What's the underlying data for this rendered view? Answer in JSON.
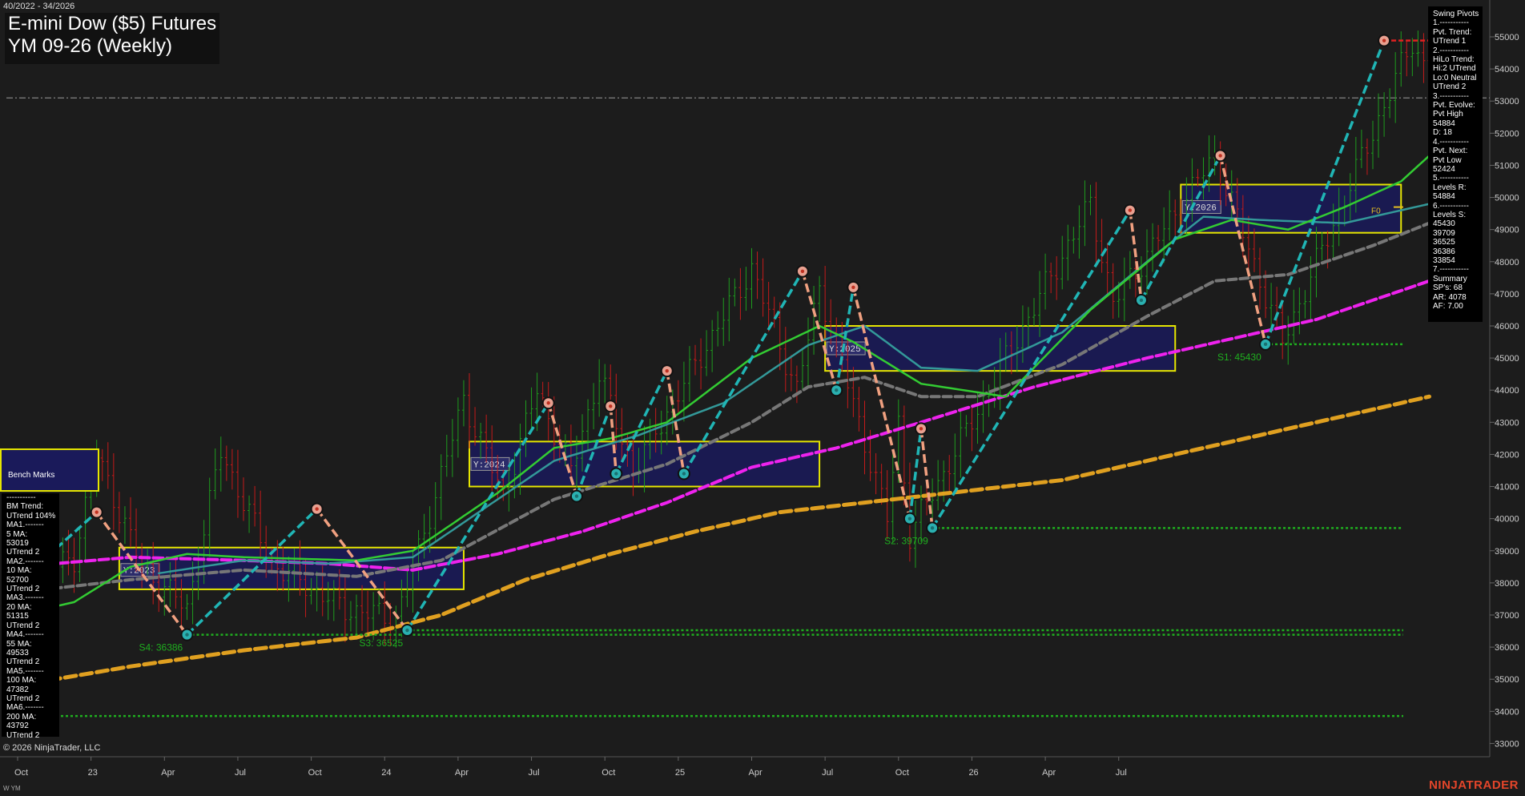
{
  "header": {
    "date_range": "40/2022 - 34/2026",
    "title_line1": "E-mini Dow ($5) Futures",
    "title_line2": "YM 09-26 (Weekly)",
    "copyright": "© 2026 NinjaTrader, LLC",
    "instrument_tag": "W YM",
    "brand": "NINJATRADER"
  },
  "swing_panel": {
    "lines": [
      "Swing Pivots",
      "1.-----------",
      "Pvt. Trend:",
      "UTrend 1",
      "2.-----------",
      "HiLo Trend:",
      "Hi:2 UTrend",
      "Lo:0 Neutral",
      "UTrend 2",
      "3.-----------",
      "Pvt. Evolve:",
      "Pvt High",
      "54884",
      "D: 18",
      "4.-----------",
      "Pvt. Next:",
      "Pvt Low",
      "52424",
      "5.-----------",
      "Levels R:",
      "54884",
      "6.-----------",
      "Levels S:",
      "45430",
      "39709",
      "36525",
      "36386",
      "33854",
      "7.-----------",
      "Summary",
      "SP's: 68",
      "AR: 4078",
      "AF: 7.00"
    ]
  },
  "bench_panel": {
    "heading": "Bench Marks",
    "lines": [
      "-----------",
      "BM Trend:",
      "UTrend 104%",
      "MA1.-------",
      "5 MA:",
      "53019",
      "UTrend 2",
      "MA2.-------",
      "10 MA:",
      "52700",
      "UTrend 2",
      "MA3.-------",
      "20 MA:",
      "51315",
      "UTrend 2",
      "MA4.-------",
      "55 MA:",
      "49533",
      "UTrend 2",
      "MA5.-------",
      "100 MA:",
      "47382",
      "UTrend 2",
      "MA6.-------",
      "200 MA:",
      "43792",
      "UTrend 2"
    ]
  },
  "colors": {
    "background": "#1c1c1c",
    "up_bar": "#1e9c1e",
    "down_bar": "#c41a1a",
    "ma_fast": "#33cc33",
    "ma_mid": "#339999",
    "ma_grey": "#777777",
    "ma_magenta": "#ee22ee",
    "ma_orange": "#e0a020",
    "swing_up": "#20b5b5",
    "swing_down": "#f0a080",
    "support": "#1fae1f",
    "year_box_fill": "#1a1a5a",
    "year_box_border": "#e6e600"
  },
  "chart_data": {
    "type": "candlestick",
    "y_axis": {
      "min": 32500,
      "max": 56000,
      "ticks": [
        33000,
        34000,
        35000,
        36000,
        37000,
        38000,
        39000,
        40000,
        41000,
        42000,
        43000,
        44000,
        45000,
        46000,
        47000,
        48000,
        49000,
        50000,
        51000,
        52000,
        53000,
        54000,
        55000
      ],
      "tick_labels": [
        "33000",
        "34000",
        "35000",
        "36000",
        "37000",
        "38000",
        "39000",
        "40000",
        "41000",
        "42000",
        "43000",
        "44000",
        "45000",
        "46000",
        "47000",
        "48000",
        "49000",
        "50000",
        "51000",
        "52000",
        "53000",
        "54000",
        "55000"
      ]
    },
    "x_axis": {
      "labels": [
        "Oct",
        "23",
        "Apr",
        "Jul",
        "Oct",
        "24",
        "Apr",
        "Jul",
        "Oct",
        "25",
        "Apr",
        "Jul",
        "Oct",
        "26",
        "Apr",
        "Jul"
      ]
    },
    "last_price": 53100,
    "series_anchors": {
      "price_path": [
        [
          0,
          37800
        ],
        [
          10,
          38800
        ],
        [
          14,
          42000
        ],
        [
          22,
          38500
        ],
        [
          30,
          37200
        ],
        [
          36,
          42100
        ],
        [
          45,
          38600
        ],
        [
          58,
          37200
        ],
        [
          67,
          36900
        ],
        [
          70,
          38400
        ],
        [
          79,
          43700
        ],
        [
          86,
          40700
        ],
        [
          92,
          44000
        ],
        [
          98,
          41500
        ],
        [
          103,
          44500
        ],
        [
          109,
          41500
        ],
        [
          130,
          47800
        ],
        [
          138,
          44000
        ],
        [
          142,
          47200
        ],
        [
          154,
          40000
        ],
        [
          156,
          43000
        ],
        [
          158,
          39500
        ],
        [
          190,
          49800
        ],
        [
          194,
          46700
        ],
        [
          212,
          51300
        ],
        [
          224,
          45500
        ],
        [
          247,
          54884
        ],
        [
          252,
          53000
        ]
      ],
      "ma_fast": [
        [
          0,
          37000
        ],
        [
          10,
          37400
        ],
        [
          20,
          38500
        ],
        [
          30,
          38900
        ],
        [
          40,
          38800
        ],
        [
          60,
          38700
        ],
        [
          70,
          39000
        ],
        [
          85,
          40800
        ],
        [
          95,
          42200
        ],
        [
          105,
          42500
        ],
        [
          115,
          43000
        ],
        [
          130,
          45000
        ],
        [
          142,
          46000
        ],
        [
          148,
          45500
        ],
        [
          160,
          44200
        ],
        [
          175,
          43800
        ],
        [
          190,
          46500
        ],
        [
          205,
          48700
        ],
        [
          215,
          49300
        ],
        [
          225,
          49000
        ],
        [
          235,
          49700
        ],
        [
          245,
          50500
        ],
        [
          250,
          51300
        ]
      ],
      "ma_mid": [
        [
          25,
          38300
        ],
        [
          40,
          38700
        ],
        [
          55,
          38600
        ],
        [
          70,
          38800
        ],
        [
          80,
          40000
        ],
        [
          95,
          41800
        ],
        [
          110,
          42600
        ],
        [
          125,
          43600
        ],
        [
          140,
          45400
        ],
        [
          150,
          46000
        ],
        [
          160,
          44700
        ],
        [
          170,
          44600
        ],
        [
          185,
          45800
        ],
        [
          200,
          48000
        ],
        [
          210,
          49400
        ],
        [
          220,
          49300
        ],
        [
          235,
          49200
        ],
        [
          245,
          49600
        ],
        [
          250,
          49800
        ]
      ],
      "ma_grey": [
        [
          0,
          37700
        ],
        [
          20,
          38100
        ],
        [
          40,
          38400
        ],
        [
          60,
          38200
        ],
        [
          75,
          38700
        ],
        [
          95,
          40600
        ],
        [
          115,
          41700
        ],
        [
          130,
          43000
        ],
        [
          140,
          44100
        ],
        [
          150,
          44400
        ],
        [
          160,
          43800
        ],
        [
          170,
          43800
        ],
        [
          185,
          44800
        ],
        [
          200,
          46300
        ],
        [
          212,
          47400
        ],
        [
          225,
          47600
        ],
        [
          240,
          48500
        ],
        [
          250,
          49200
        ]
      ],
      "ma_magenta": [
        [
          0,
          38500
        ],
        [
          20,
          38800
        ],
        [
          40,
          38700
        ],
        [
          55,
          38600
        ],
        [
          70,
          38400
        ],
        [
          85,
          38900
        ],
        [
          100,
          39600
        ],
        [
          115,
          40500
        ],
        [
          130,
          41600
        ],
        [
          145,
          42200
        ],
        [
          160,
          43000
        ],
        [
          180,
          44100
        ],
        [
          200,
          45000
        ],
        [
          215,
          45600
        ],
        [
          230,
          46200
        ],
        [
          245,
          47100
        ],
        [
          250,
          47400
        ]
      ],
      "ma_orange": [
        [
          0,
          34800
        ],
        [
          20,
          35400
        ],
        [
          40,
          35900
        ],
        [
          60,
          36300
        ],
        [
          75,
          37000
        ],
        [
          90,
          38100
        ],
        [
          105,
          38900
        ],
        [
          120,
          39600
        ],
        [
          135,
          40200
        ],
        [
          150,
          40500
        ],
        [
          165,
          40800
        ],
        [
          185,
          41200
        ],
        [
          200,
          41800
        ],
        [
          215,
          42400
        ],
        [
          230,
          43000
        ],
        [
          245,
          43600
        ],
        [
          250,
          43800
        ]
      ]
    },
    "swing_pivots": [
      {
        "i": 14,
        "price": 40200,
        "type": "high"
      },
      {
        "i": 30,
        "price": 36386,
        "type": "low"
      },
      {
        "i": 53,
        "price": 40300,
        "type": "high"
      },
      {
        "i": 69,
        "price": 36525,
        "type": "low"
      },
      {
        "i": 94,
        "price": 43600,
        "type": "high"
      },
      {
        "i": 99,
        "price": 40700,
        "type": "low"
      },
      {
        "i": 105,
        "price": 43500,
        "type": "high"
      },
      {
        "i": 106,
        "price": 41400,
        "type": "low"
      },
      {
        "i": 115,
        "price": 44600,
        "type": "high"
      },
      {
        "i": 118,
        "price": 41400,
        "type": "low"
      },
      {
        "i": 139,
        "price": 47700,
        "type": "high"
      },
      {
        "i": 145,
        "price": 44000,
        "type": "low"
      },
      {
        "i": 148,
        "price": 47200,
        "type": "high"
      },
      {
        "i": 158,
        "price": 40000,
        "type": "low"
      },
      {
        "i": 160,
        "price": 42800,
        "type": "high"
      },
      {
        "i": 162,
        "price": 39709,
        "type": "low"
      },
      {
        "i": 197,
        "price": 49600,
        "type": "high"
      },
      {
        "i": 199,
        "price": 46800,
        "type": "low"
      },
      {
        "i": 213,
        "price": 51300,
        "type": "high"
      },
      {
        "i": 221,
        "price": 45430,
        "type": "low"
      },
      {
        "i": 242,
        "price": 54884,
        "type": "high"
      }
    ],
    "support_levels": [
      {
        "price": 45430,
        "label": "S1: 45430",
        "from_i": 221
      },
      {
        "price": 39709,
        "label": "S2: 39709",
        "from_i": 162
      },
      {
        "price": 36525,
        "label": "S3: 36525",
        "from_i": 69
      },
      {
        "price": 36386,
        "label": "S4: 36386",
        "from_i": 30
      },
      {
        "price": 33854,
        "label": "",
        "from_i": 0
      }
    ],
    "resistance_level": {
      "price": 53100
    },
    "year_boxes": [
      {
        "label": "Y:2023",
        "from_i": 18,
        "to_i": 79,
        "high": 39100,
        "low": 37800
      },
      {
        "label": "Y:2024",
        "from_i": 80,
        "to_i": 142,
        "high": 42400,
        "low": 41000
      },
      {
        "label": "Y:2025",
        "from_i": 143,
        "to_i": 205,
        "high": 46000,
        "low": 44600
      },
      {
        "label": "Y:2026",
        "from_i": 206,
        "to_i": 245,
        "high": 50400,
        "low": 48900
      }
    ],
    "fo_label": "F0"
  }
}
